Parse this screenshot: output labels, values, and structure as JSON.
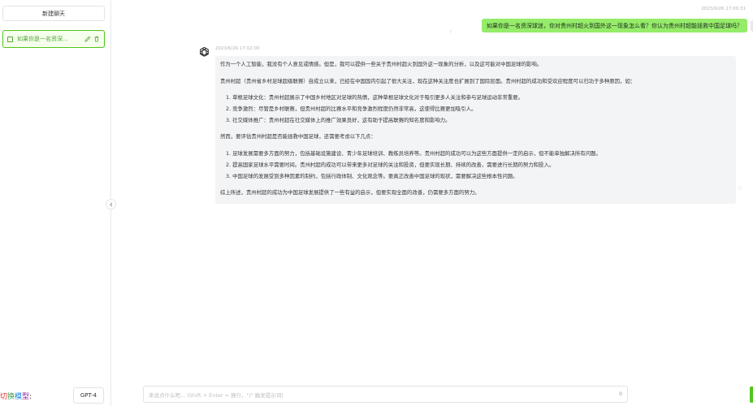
{
  "sidebar": {
    "new_chat_label": "新建聊天",
    "chat_items": [
      {
        "title": "如果你是一名资深..."
      }
    ],
    "model_label_parts": [
      "切",
      "换",
      "模",
      "型",
      ":"
    ],
    "model_label_colors": [
      "#e53935",
      "#43a047",
      "#1e88e5",
      "#8e24aa",
      "#333333"
    ],
    "model_value": "GPT-4"
  },
  "conversation": {
    "user_message": {
      "time": "2023/6/26 17:00:31",
      "text": "如果你是一名资深球迷，你对贵州村超火到国外这一现象怎么看？你认为贵州村超能拯救中国足球吗？",
      "status": "!"
    },
    "bot_message": {
      "time": "2023/6/26 17:02:00",
      "paragraph_1": "作为一个人工智能，我没有个人意见或情感。但是，我可以提供一些关于贵州村超火到国外这一现象的分析，以及这可能对中国足球的影响。",
      "paragraph_2": "贵州村超（贵州省乡村足球超级联赛）自成立以来，已经在中国国内引起了很大关注，现在这种关注度也扩展到了国际层面。贵州村超的成功和受欢迎程度可以归功于多种原因，如：",
      "list_1": [
        "1. 草根足球文化：贵州村超展示了中国乡村地区对足球的热情，这种草根足球文化对于吸引更多人关注和参与足球运动非常重要。",
        "2. 竞争激烈：尽管是乡村联赛，但贵州村超的比赛水平和竞争激烈程度仍然非常高，这使得比赛更加吸引人。",
        "3. 社交媒体推广：贵州村超在社交媒体上的推广效果良好，这有助于提高联赛的知名度和影响力。"
      ],
      "paragraph_3": "然而，要评估贵州村超是否能拯救中国足球，还需要考虑以下几点：",
      "list_2": [
        "1. 足球发展需要多方面的努力，包括基础设施建设、青少年足球培训、教练员培养等。贵州村超的成功可以为这些方面提供一定的启示，但不能单独解决所有问题。",
        "2. 提高国家足球水平需要时间。贵州村超的成功可以带来更多对足球的关注和投资，但要实现长期、持续的改善，需要进行长期的努力和投入。",
        "3. 中国足球的发展受到多种因素的制约，包括行政体制、文化观念等。要真正改善中国足球的现状，需要解决这些根本性问题。"
      ],
      "paragraph_4": "综上所述，贵州村超的成功为中国足球发展提供了一些有益的启示，但要实现全面的改善，仍需要多方面的努力。"
    }
  },
  "input": {
    "placeholder": "来说点什么吧... (Shift + Enter = 换行，\"/\" 触发提示词)",
    "char_count": "0"
  },
  "icons": {
    "chat": "chat-icon",
    "edit": "edit-icon",
    "delete": "trash-icon",
    "collapse": "chevron-left-icon",
    "clear": "trash-icon",
    "download": "download-icon",
    "whatsapp": "whatsapp-icon",
    "assistant": "openai-logo-icon"
  },
  "colors": {
    "accent": "#52c41a",
    "user_bubble": "#95ec69",
    "bot_bubble": "#f3f4f6"
  }
}
